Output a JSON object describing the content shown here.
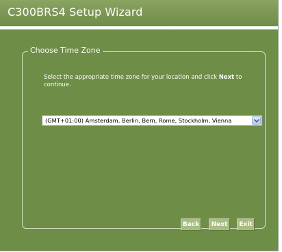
{
  "window": {
    "title": "C300BRS4 Setup Wizard"
  },
  "section": {
    "legend": "Choose Time Zone"
  },
  "instructions": {
    "before": "Select the appropriate time zone for your location and click ",
    "bold": "Next",
    "after": " to continue."
  },
  "timezone": {
    "selected": "(GMT+01:00) Amsterdam, Berlin, Bern, Rome, Stockholm, Vienna"
  },
  "buttons": {
    "back": "Back",
    "next": "Next",
    "exit": "Exit"
  },
  "colors": {
    "panel": "#6e8d46",
    "title_bar": "#7b9751",
    "button": "#a7bd82",
    "text": "#ffffff"
  }
}
